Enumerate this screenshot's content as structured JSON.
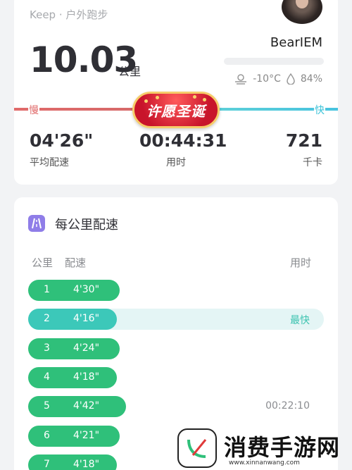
{
  "header": {
    "source": "Keep · 户外跑步",
    "username": "BearIEM",
    "weather": {
      "condition_icon": "haze-icon",
      "temperature": "-10°C",
      "humidity_icon": "water-drop-icon",
      "humidity": "84%"
    }
  },
  "summary": {
    "distance": "10.03",
    "distance_unit": "公里",
    "slow_label": "慢",
    "fast_label": "快",
    "promo_label": "许愿圣诞",
    "stats": [
      {
        "value": "04'26\"",
        "label": "平均配速"
      },
      {
        "value": "00:44:31",
        "label": "用时"
      },
      {
        "value": "721",
        "label": "千卡"
      }
    ]
  },
  "pace_section": {
    "title": "每公里配速",
    "icon": "road-icon",
    "columns": {
      "km": "公里",
      "pace": "配速",
      "time": "用时"
    },
    "rows": [
      {
        "km": "1",
        "pace": "4'30\"",
        "fraction": 0.31
      },
      {
        "km": "2",
        "pace": "4'16\"",
        "fraction": 0.3,
        "tag": "最快",
        "best": true
      },
      {
        "km": "3",
        "pace": "4'24\"",
        "fraction": 0.31
      },
      {
        "km": "4",
        "pace": "4'18\"",
        "fraction": 0.3
      },
      {
        "km": "5",
        "pace": "4'42\"",
        "fraction": 0.33,
        "elapsed": "00:22:10"
      },
      {
        "km": "6",
        "pace": "4'21\"",
        "fraction": 0.31
      },
      {
        "km": "7",
        "pace": "4'18\"",
        "fraction": 0.3
      }
    ]
  },
  "watermark": {
    "text": "消费手游网",
    "url": "www.xinnanwang.com"
  },
  "colors": {
    "accent_green": "#2fc07a",
    "best_teal": "#3cc8b9",
    "slow_red": "#e06a6a",
    "fast_cyan": "#47c3df"
  }
}
